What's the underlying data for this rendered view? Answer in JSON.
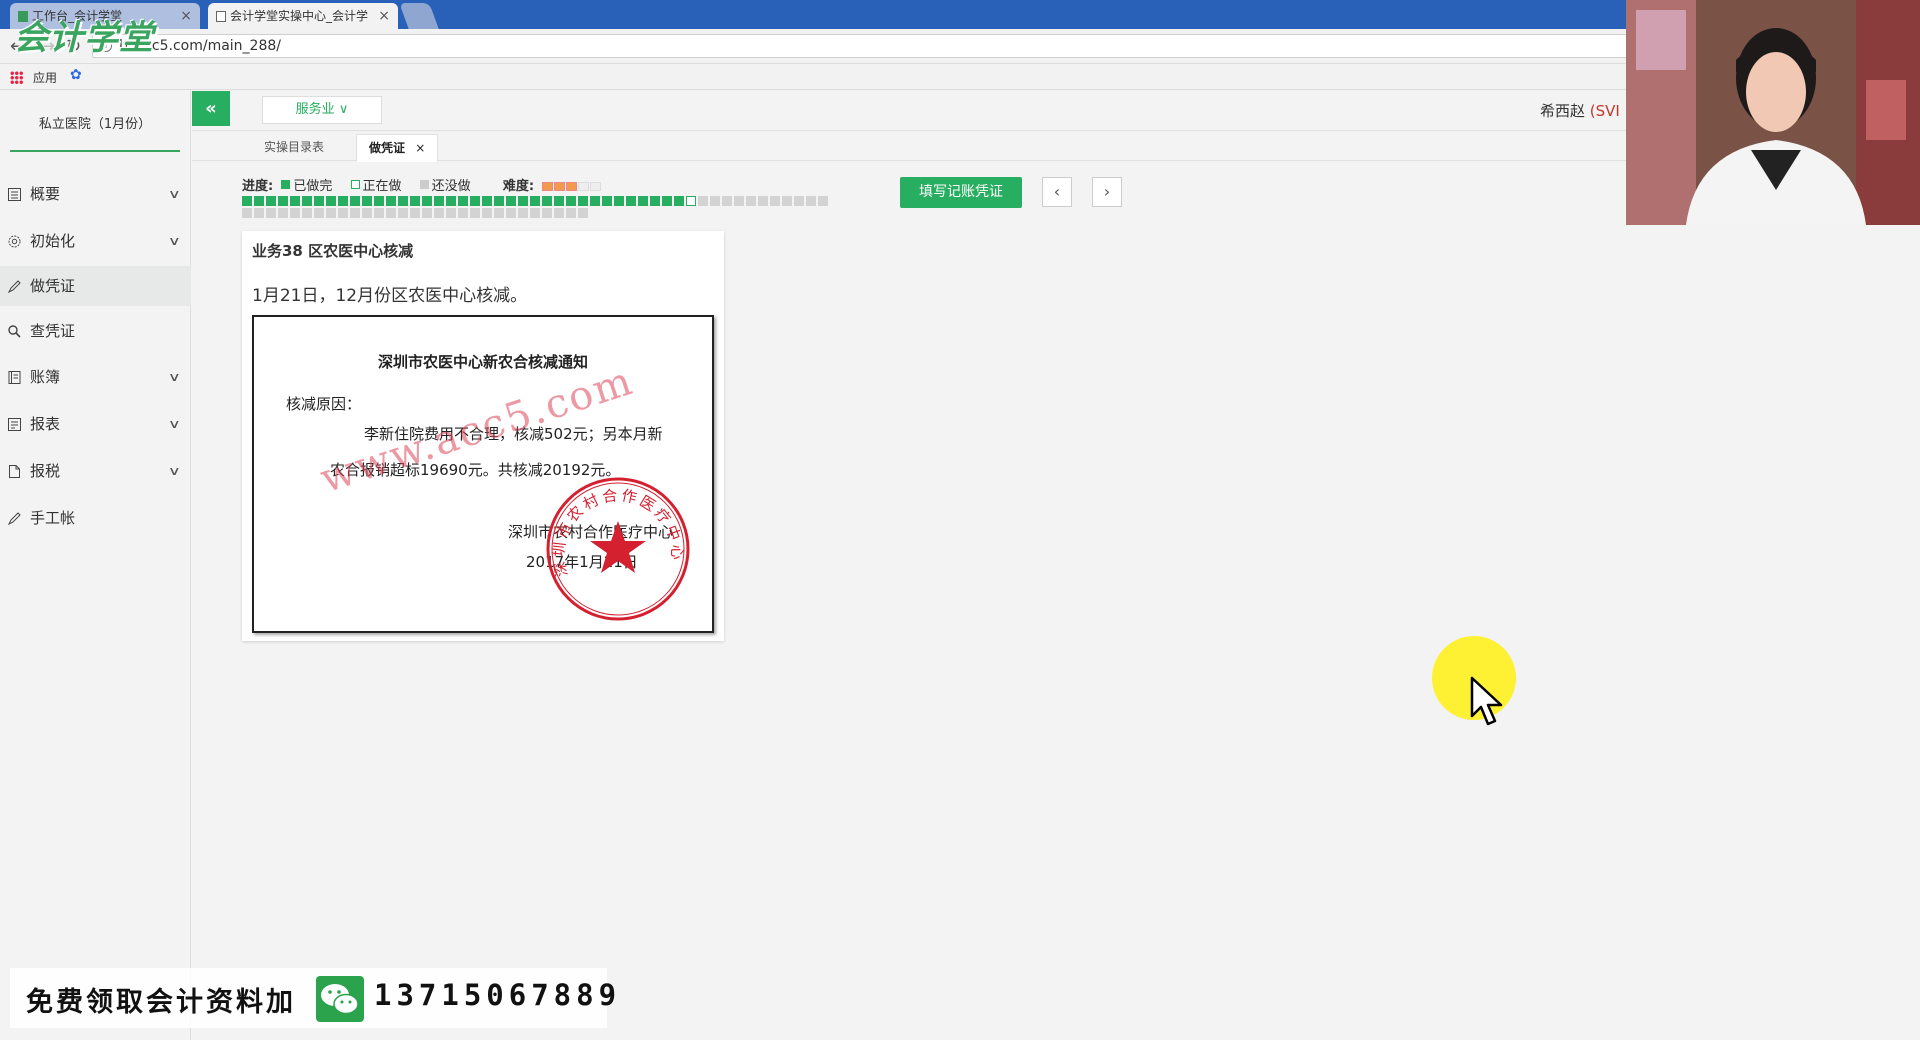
{
  "browser": {
    "tabs": [
      {
        "label": "工作台_会计学堂"
      },
      {
        "label": "会计学堂实操中心_会计学"
      }
    ],
    "url": "lx.acc5.com/main_288/",
    "bookmarks": {
      "apps_label": "应用"
    }
  },
  "logo": "会计学堂",
  "sidebar": {
    "org": "私立医院（1月份）",
    "items": [
      {
        "label": "概要",
        "icon": "overview-icon",
        "expandable": true
      },
      {
        "label": "初始化",
        "icon": "gear-icon",
        "expandable": true
      },
      {
        "label": "做凭证",
        "icon": "pen-icon",
        "expandable": false,
        "active": true
      },
      {
        "label": "查凭证",
        "icon": "search-icon",
        "expandable": false
      },
      {
        "label": "账簿",
        "icon": "ledger-icon",
        "expandable": true
      },
      {
        "label": "报表",
        "icon": "report-icon",
        "expandable": true
      },
      {
        "label": "报税",
        "icon": "file-icon",
        "expandable": true
      },
      {
        "label": "手工帐",
        "icon": "pen-icon",
        "expandable": false
      }
    ]
  },
  "header": {
    "collapse_icon": "«",
    "industry": "服务业",
    "user_name": "希西赵",
    "user_badge": "(SVI"
  },
  "subtabs": [
    {
      "label": "实操目录表",
      "active": false
    },
    {
      "label": "做凭证",
      "active": true,
      "close": "×"
    }
  ],
  "progress": {
    "label": "进度:",
    "legend": {
      "done": "已做完",
      "doing": "正在做",
      "todo": "还没做"
    },
    "difficulty_label": "难度:",
    "difficulty_stars": 3,
    "difficulty_max": 5,
    "total": 78,
    "done": 37,
    "current": 38
  },
  "actions": {
    "fill_voucher": "填写记账凭证",
    "prev": "‹",
    "next": "›"
  },
  "task": {
    "title": "业务38 区农医中心核减",
    "description": "1月21日，12月份区农医中心核减。",
    "document": {
      "title": "深圳市农医中心新农合核减通知",
      "reason_label": "核减原因：",
      "line1": "李新住院费用不合理，核减502元；另本月新",
      "line2": "农合报销超标19690元。共核减20192元。",
      "org": "深圳市农村合作医疗中心",
      "date": "2017年1月21日",
      "watermark": "www.acc5.com",
      "seal_text": "深圳市农村合作医疗中心"
    }
  },
  "promo": {
    "text": "免费领取会计资料加",
    "phone": "13715067889"
  },
  "colors": {
    "accent": "#27ae60",
    "tabbar": "#2a61b8",
    "seal": "#d4202f"
  }
}
